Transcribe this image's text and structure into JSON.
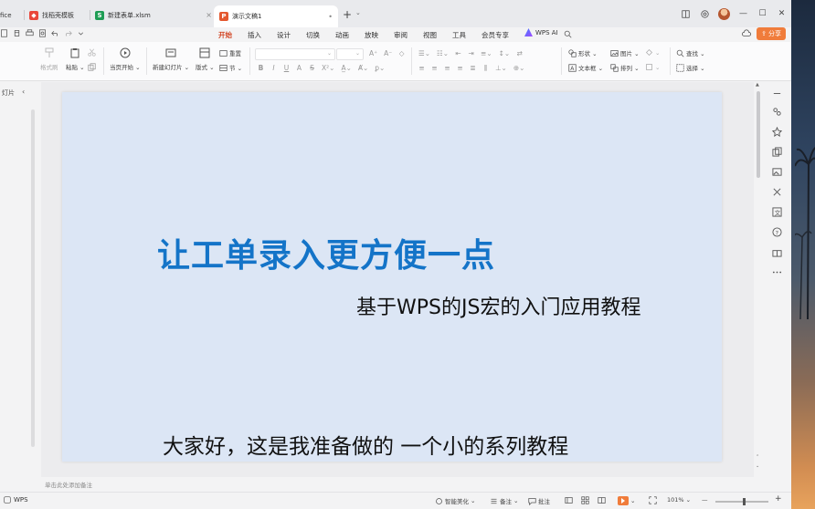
{
  "tabs": [
    {
      "label": "fice",
      "badge_color": "",
      "badge_letter": ""
    },
    {
      "label": "找稻壳模板",
      "badge_color": "#e9463a",
      "badge_letter": ""
    },
    {
      "label": "新建表单.xlsm",
      "badge_color": "#1f9d55",
      "badge_letter": "S"
    },
    {
      "label": "演示文稿1",
      "badge_color": "#e4572e",
      "badge_letter": "P",
      "close": "•",
      "active": true
    }
  ],
  "new_tab": "+",
  "new_tab_dropdown": "⌄",
  "window_controls": {
    "minimize": "—",
    "maximize": "☐",
    "close": "✕"
  },
  "menu": {
    "items": [
      "开始",
      "插入",
      "设计",
      "切换",
      "动画",
      "放映",
      "审阅",
      "视图",
      "工具",
      "会员专享"
    ],
    "active": "开始",
    "wps_ai": "WPS AI",
    "share": "分享"
  },
  "ribbon": {
    "format_painter": "格式刷",
    "paste": "粘贴",
    "from_current": "当页开始",
    "new_slide": "新建幻灯片",
    "layout": "版式",
    "section": "节",
    "reset": "重置",
    "shape": "形状",
    "picture": "图片",
    "textbox": "文本框",
    "arrange": "排列",
    "find": "查找",
    "select": "选择",
    "font_name": "",
    "font_size": ""
  },
  "left_panel": {
    "title": "灯片",
    "collapse": "‹"
  },
  "slide": {
    "title": "让工单录入更方便一点",
    "subtitle": "基于WPS的JS宏的入门应用教程",
    "caption": "大家好，这是我准备做的 一个小的系列教程"
  },
  "notes_placeholder": "单击此处添加备注",
  "statusbar": {
    "app": "WPS",
    "smart_beautify": "智能美化",
    "notes": "备注",
    "comments": "批注",
    "zoom": "101%",
    "zoom_minus": "—",
    "zoom_plus": "+",
    "zoom_level": 0.55
  },
  "colors": {
    "accent": "#d24726",
    "title_blue": "#1474c8",
    "slide_bg": "#dce6f5",
    "share_orange": "#f07c3b"
  }
}
